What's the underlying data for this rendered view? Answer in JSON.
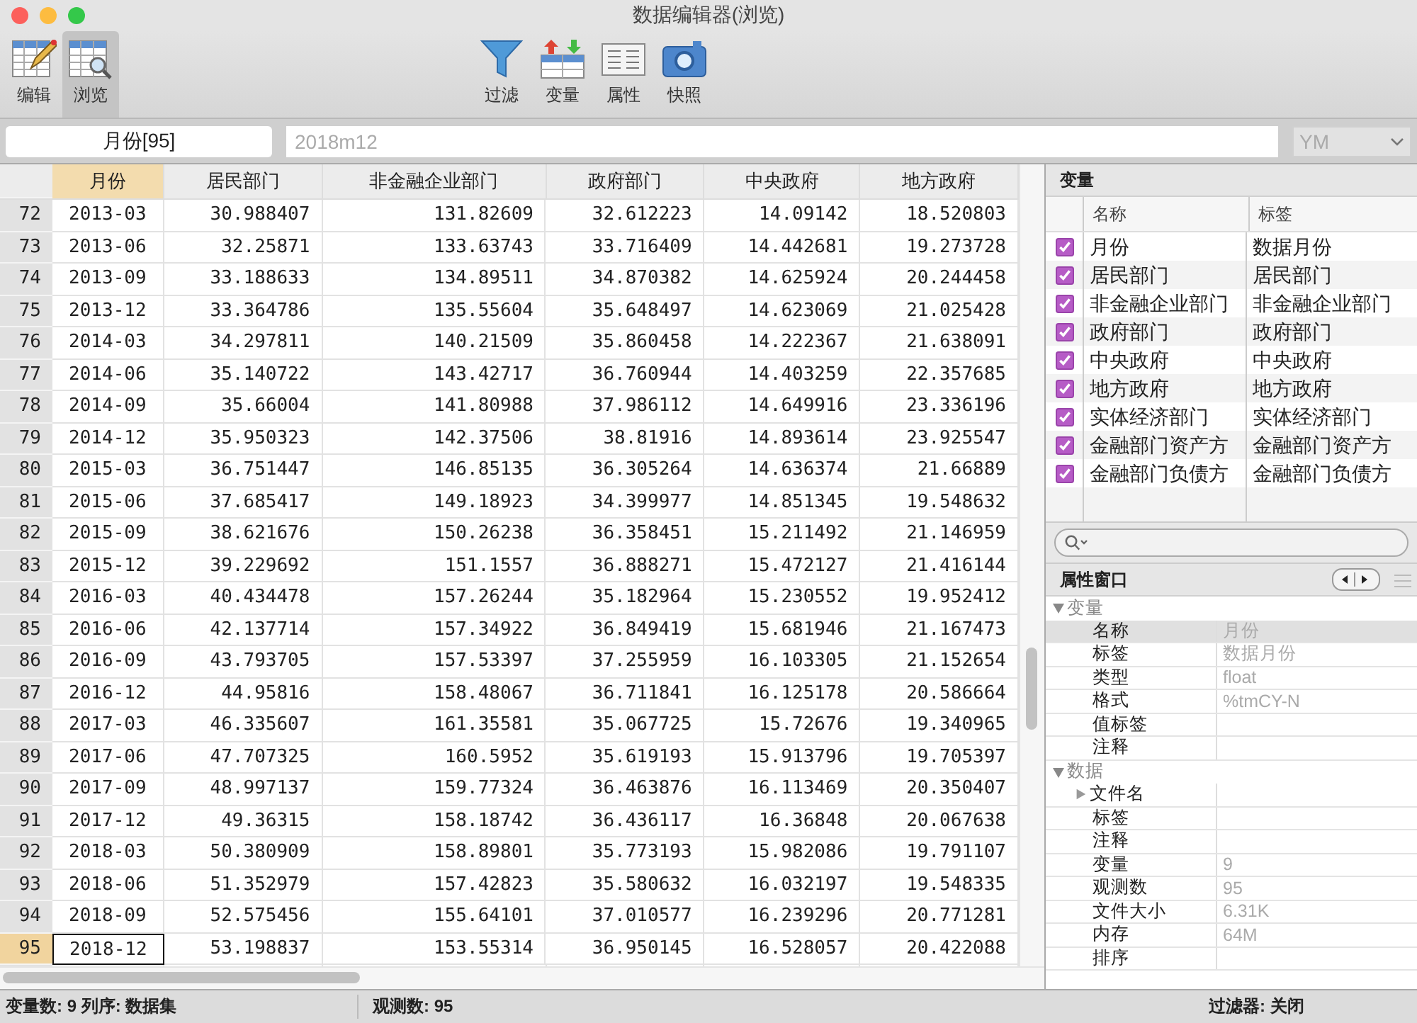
{
  "window": {
    "title": "数据编辑器(浏览)"
  },
  "modes": [
    {
      "label": "编辑",
      "kind": "edit",
      "selected": false
    },
    {
      "label": "浏览",
      "kind": "browse",
      "selected": true
    }
  ],
  "tools": [
    {
      "label": "过滤",
      "kind": "filter"
    },
    {
      "label": "变量",
      "kind": "variables"
    },
    {
      "label": "属性",
      "kind": "properties"
    },
    {
      "label": "快照",
      "kind": "snapshot"
    }
  ],
  "cell_bar": {
    "cell_name": "月份[95]",
    "value": "2018m12",
    "format": "YM"
  },
  "table": {
    "columns": [
      {
        "label": "月份",
        "selected": true
      },
      {
        "label": "居民部门",
        "selected": false
      },
      {
        "label": "非金融企业部门",
        "selected": false
      },
      {
        "label": "政府部门",
        "selected": false
      },
      {
        "label": "中央政府",
        "selected": false
      },
      {
        "label": "地方政府",
        "selected": false
      }
    ],
    "rows": [
      {
        "index": "72",
        "selected": false,
        "cells": [
          "2013-03",
          "30.988407",
          "131.82609",
          "32.612223",
          "14.09142",
          "18.520803"
        ]
      },
      {
        "index": "73",
        "selected": false,
        "cells": [
          "2013-06",
          "32.25871",
          "133.63743",
          "33.716409",
          "14.442681",
          "19.273728"
        ]
      },
      {
        "index": "74",
        "selected": false,
        "cells": [
          "2013-09",
          "33.188633",
          "134.89511",
          "34.870382",
          "14.625924",
          "20.244458"
        ]
      },
      {
        "index": "75",
        "selected": false,
        "cells": [
          "2013-12",
          "33.364786",
          "135.55604",
          "35.648497",
          "14.623069",
          "21.025428"
        ]
      },
      {
        "index": "76",
        "selected": false,
        "cells": [
          "2014-03",
          "34.297811",
          "140.21509",
          "35.860458",
          "14.222367",
          "21.638091"
        ]
      },
      {
        "index": "77",
        "selected": false,
        "cells": [
          "2014-06",
          "35.140722",
          "143.42717",
          "36.760944",
          "14.403259",
          "22.357685"
        ]
      },
      {
        "index": "78",
        "selected": false,
        "cells": [
          "2014-09",
          "35.66004",
          "141.80988",
          "37.986112",
          "14.649916",
          "23.336196"
        ]
      },
      {
        "index": "79",
        "selected": false,
        "cells": [
          "2014-12",
          "35.950323",
          "142.37506",
          "38.81916",
          "14.893614",
          "23.925547"
        ]
      },
      {
        "index": "80",
        "selected": false,
        "cells": [
          "2015-03",
          "36.751447",
          "146.85135",
          "36.305264",
          "14.636374",
          "21.66889"
        ]
      },
      {
        "index": "81",
        "selected": false,
        "cells": [
          "2015-06",
          "37.685417",
          "149.18923",
          "34.399977",
          "14.851345",
          "19.548632"
        ]
      },
      {
        "index": "82",
        "selected": false,
        "cells": [
          "2015-09",
          "38.621676",
          "150.26238",
          "36.358451",
          "15.211492",
          "21.146959"
        ]
      },
      {
        "index": "83",
        "selected": false,
        "cells": [
          "2015-12",
          "39.229692",
          "151.1557",
          "36.888271",
          "15.472127",
          "21.416144"
        ]
      },
      {
        "index": "84",
        "selected": false,
        "cells": [
          "2016-03",
          "40.434478",
          "157.26244",
          "35.182964",
          "15.230552",
          "19.952412"
        ]
      },
      {
        "index": "85",
        "selected": false,
        "cells": [
          "2016-06",
          "42.137714",
          "157.34922",
          "36.849419",
          "15.681946",
          "21.167473"
        ]
      },
      {
        "index": "86",
        "selected": false,
        "cells": [
          "2016-09",
          "43.793705",
          "157.53397",
          "37.255959",
          "16.103305",
          "21.152654"
        ]
      },
      {
        "index": "87",
        "selected": false,
        "cells": [
          "2016-12",
          "44.95816",
          "158.48067",
          "36.711841",
          "16.125178",
          "20.586664"
        ]
      },
      {
        "index": "88",
        "selected": false,
        "cells": [
          "2017-03",
          "46.335607",
          "161.35581",
          "35.067725",
          "15.72676",
          "19.340965"
        ]
      },
      {
        "index": "89",
        "selected": false,
        "cells": [
          "2017-06",
          "47.707325",
          "160.5952",
          "35.619193",
          "15.913796",
          "19.705397"
        ]
      },
      {
        "index": "90",
        "selected": false,
        "cells": [
          "2017-09",
          "48.997137",
          "159.77324",
          "36.463876",
          "16.113469",
          "20.350407"
        ]
      },
      {
        "index": "91",
        "selected": false,
        "cells": [
          "2017-12",
          "49.36315",
          "158.18742",
          "36.436117",
          "16.36848",
          "20.067638"
        ]
      },
      {
        "index": "92",
        "selected": false,
        "cells": [
          "2018-03",
          "50.380909",
          "158.89801",
          "35.773193",
          "15.982086",
          "19.791107"
        ]
      },
      {
        "index": "93",
        "selected": false,
        "cells": [
          "2018-06",
          "51.352979",
          "157.42823",
          "35.580632",
          "16.032197",
          "19.548335"
        ]
      },
      {
        "index": "94",
        "selected": false,
        "cells": [
          "2018-09",
          "52.575456",
          "155.64101",
          "37.010577",
          "16.239296",
          "20.771281"
        ]
      },
      {
        "index": "95",
        "selected": true,
        "cells": [
          "2018-12",
          "53.198837",
          "153.55314",
          "36.950145",
          "16.528057",
          "20.422088"
        ]
      }
    ]
  },
  "variables": {
    "title": "变量",
    "columns": [
      "名称",
      "标签"
    ],
    "items": [
      {
        "name": "月份",
        "label": "数据月份",
        "checked": true
      },
      {
        "name": "居民部门",
        "label": "居民部门",
        "checked": true
      },
      {
        "name": "非金融企业部门",
        "label": "非金融企业部门",
        "checked": true
      },
      {
        "name": "政府部门",
        "label": "政府部门",
        "checked": true
      },
      {
        "name": "中央政府",
        "label": "中央政府",
        "checked": true
      },
      {
        "name": "地方政府",
        "label": "地方政府",
        "checked": true
      },
      {
        "name": "实体经济部门",
        "label": "实体经济部门",
        "checked": true
      },
      {
        "name": "金融部门资产方",
        "label": "金融部门资产方",
        "checked": true
      },
      {
        "name": "金融部门负债方",
        "label": "金融部门负债方",
        "checked": true
      }
    ]
  },
  "properties": {
    "title": "属性窗口",
    "groups": [
      {
        "label": "变量",
        "expanded": true,
        "items": [
          {
            "label": "名称",
            "value": "月份",
            "selected": true
          },
          {
            "label": "标签",
            "value": "数据月份",
            "selected": false
          },
          {
            "label": "类型",
            "value": "float",
            "selected": false
          },
          {
            "label": "格式",
            "value": "%tmCY-N",
            "selected": false
          },
          {
            "label": "值标签",
            "selected": false
          },
          {
            "label": "注释",
            "selected": false
          }
        ]
      },
      {
        "label": "数据",
        "expanded": true,
        "items": [
          {
            "label": "文件名",
            "expandable": true,
            "selected": false
          },
          {
            "label": "标签",
            "selected": false
          },
          {
            "label": "注释",
            "selected": false
          },
          {
            "label": "变量",
            "value": "9",
            "selected": false
          },
          {
            "label": "观测数",
            "value": "95",
            "selected": false
          },
          {
            "label": "文件大小",
            "value": "6.31K",
            "selected": false
          },
          {
            "label": "内存",
            "value": "64M",
            "selected": false
          },
          {
            "label": "排序",
            "selected": false
          }
        ]
      }
    ]
  },
  "status_bar": {
    "left": "变量数: 9 列序: 数据集",
    "middle": "观测数: 95",
    "right": "过滤器: 关闭"
  }
}
